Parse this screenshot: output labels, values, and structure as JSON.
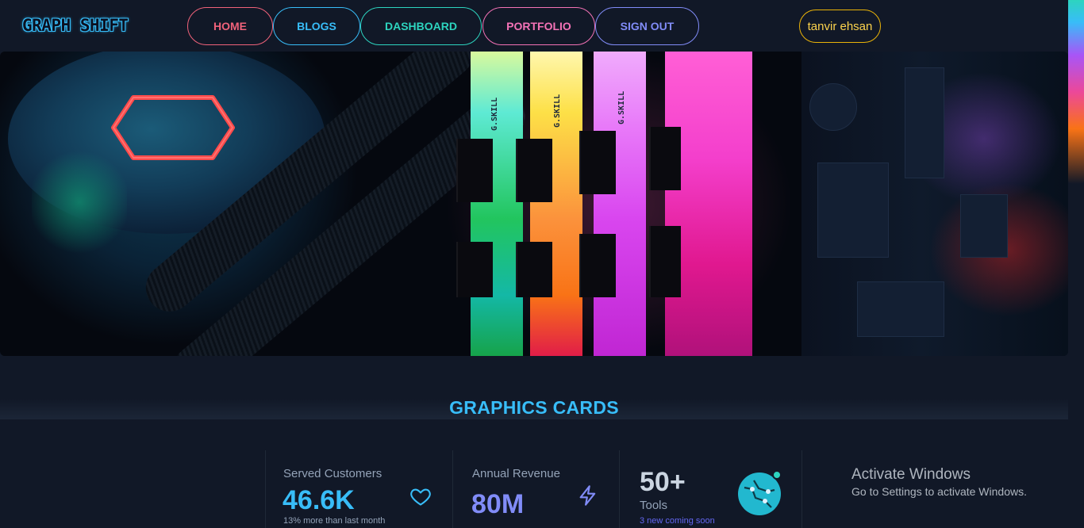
{
  "nav": {
    "logo": "GRAPH SHIFT",
    "links": [
      "HOME",
      "BLOGS",
      "DASHBOARD",
      "PORTFOLIO",
      "SIGN OUT"
    ],
    "user_name": "tanvir ehsan"
  },
  "hero": {
    "ram_labels": [
      "G.SKILL",
      "G.SKILL",
      "G.SKILL"
    ]
  },
  "section": {
    "title": "GRAPHICS CARDS"
  },
  "stats": [
    {
      "title": "Served Customers",
      "value": "46.6K",
      "desc": "13% more than last month",
      "icon": "heart-icon",
      "color": "#38bdf8"
    },
    {
      "title": "Annual Revenue",
      "value": "80M",
      "desc": "",
      "icon": "bolt-icon",
      "color": "#818cf8"
    },
    {
      "title": "Tools",
      "value": "50+",
      "desc": "3 new coming soon",
      "icon": "avatar",
      "color": "#cbd5e1"
    }
  ],
  "windows_notice": {
    "title": "Activate Windows",
    "subtitle": "Go to Settings to activate Windows."
  },
  "colors": {
    "background": "#111827",
    "accent_blue": "#38bdf8",
    "accent_indigo": "#818cf8",
    "accent_gold": "#eab308"
  }
}
